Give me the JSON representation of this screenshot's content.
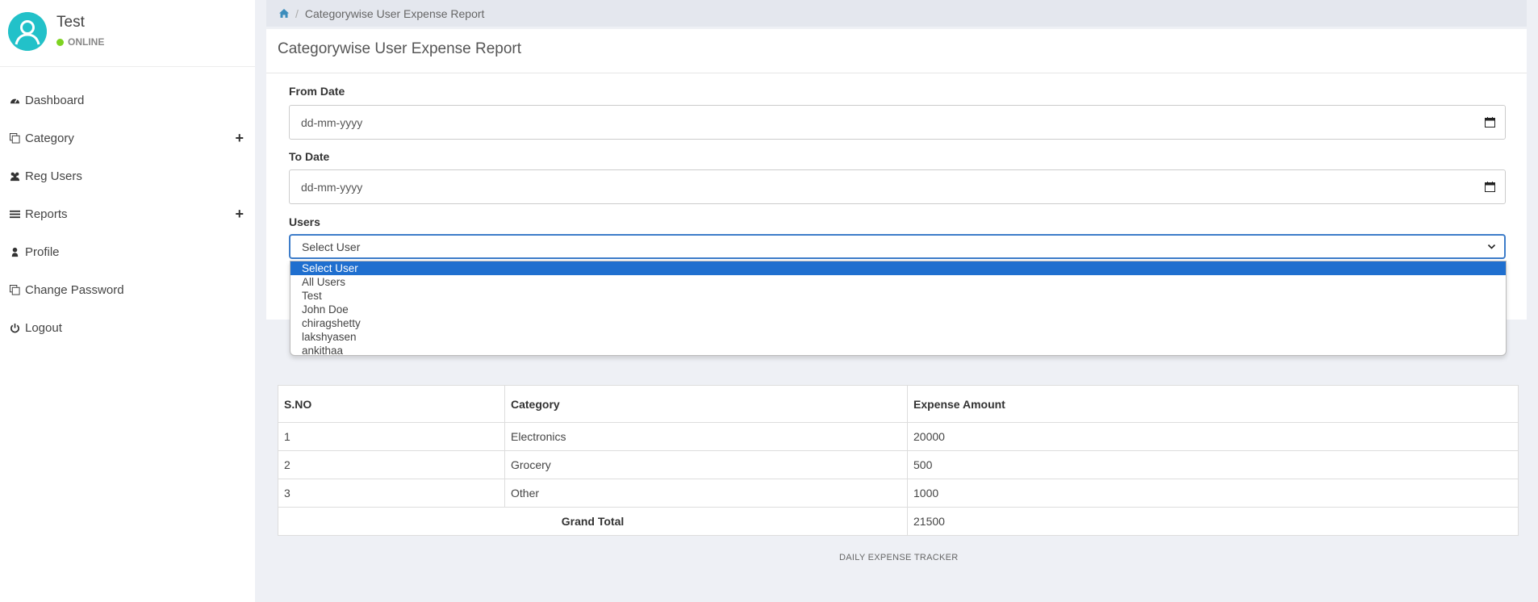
{
  "user": {
    "name": "Test",
    "status": "ONLINE"
  },
  "menu": [
    {
      "label": "Dashboard",
      "icon": "dashboard-icon",
      "expandable": false
    },
    {
      "label": "Category",
      "icon": "copy-icon",
      "expandable": true
    },
    {
      "label": "Reg Users",
      "icon": "users-icon",
      "expandable": false
    },
    {
      "label": "Reports",
      "icon": "list-icon",
      "expandable": true
    },
    {
      "label": "Profile",
      "icon": "user-icon",
      "expandable": false
    },
    {
      "label": "Change Password",
      "icon": "copy-icon",
      "expandable": false
    },
    {
      "label": "Logout",
      "icon": "power-icon",
      "expandable": false
    }
  ],
  "breadcrumb": {
    "current": "Categorywise User Expense Report",
    "separator": "/"
  },
  "panel": {
    "title": "Categorywise User Expense Report"
  },
  "form": {
    "from_date_label": "From Date",
    "from_date_placeholder": "dd-mm-yyyy",
    "to_date_label": "To Date",
    "to_date_placeholder": "dd-mm-yyyy",
    "users_label": "Users",
    "users_selected": "Select User",
    "user_options": [
      "Select User",
      "All Users",
      "Test",
      "John Doe",
      "chiragshetty",
      "lakshyasen",
      "ankithaa"
    ]
  },
  "table": {
    "headers": [
      "S.NO",
      "Category",
      "Expense Amount"
    ],
    "rows": [
      [
        "1",
        "Electronics",
        "20000"
      ],
      [
        "2",
        "Grocery",
        "500"
      ],
      [
        "3",
        "Other",
        "1000"
      ]
    ],
    "grand_total_label": "Grand Total",
    "grand_total_value": "21500"
  },
  "footer": "DAILY EXPENSE TRACKER",
  "colors": {
    "accent": "#3c8dbc",
    "selected_option": "#1f6fcf",
    "online": "#7ed321",
    "avatar": "#1cc7d0"
  }
}
